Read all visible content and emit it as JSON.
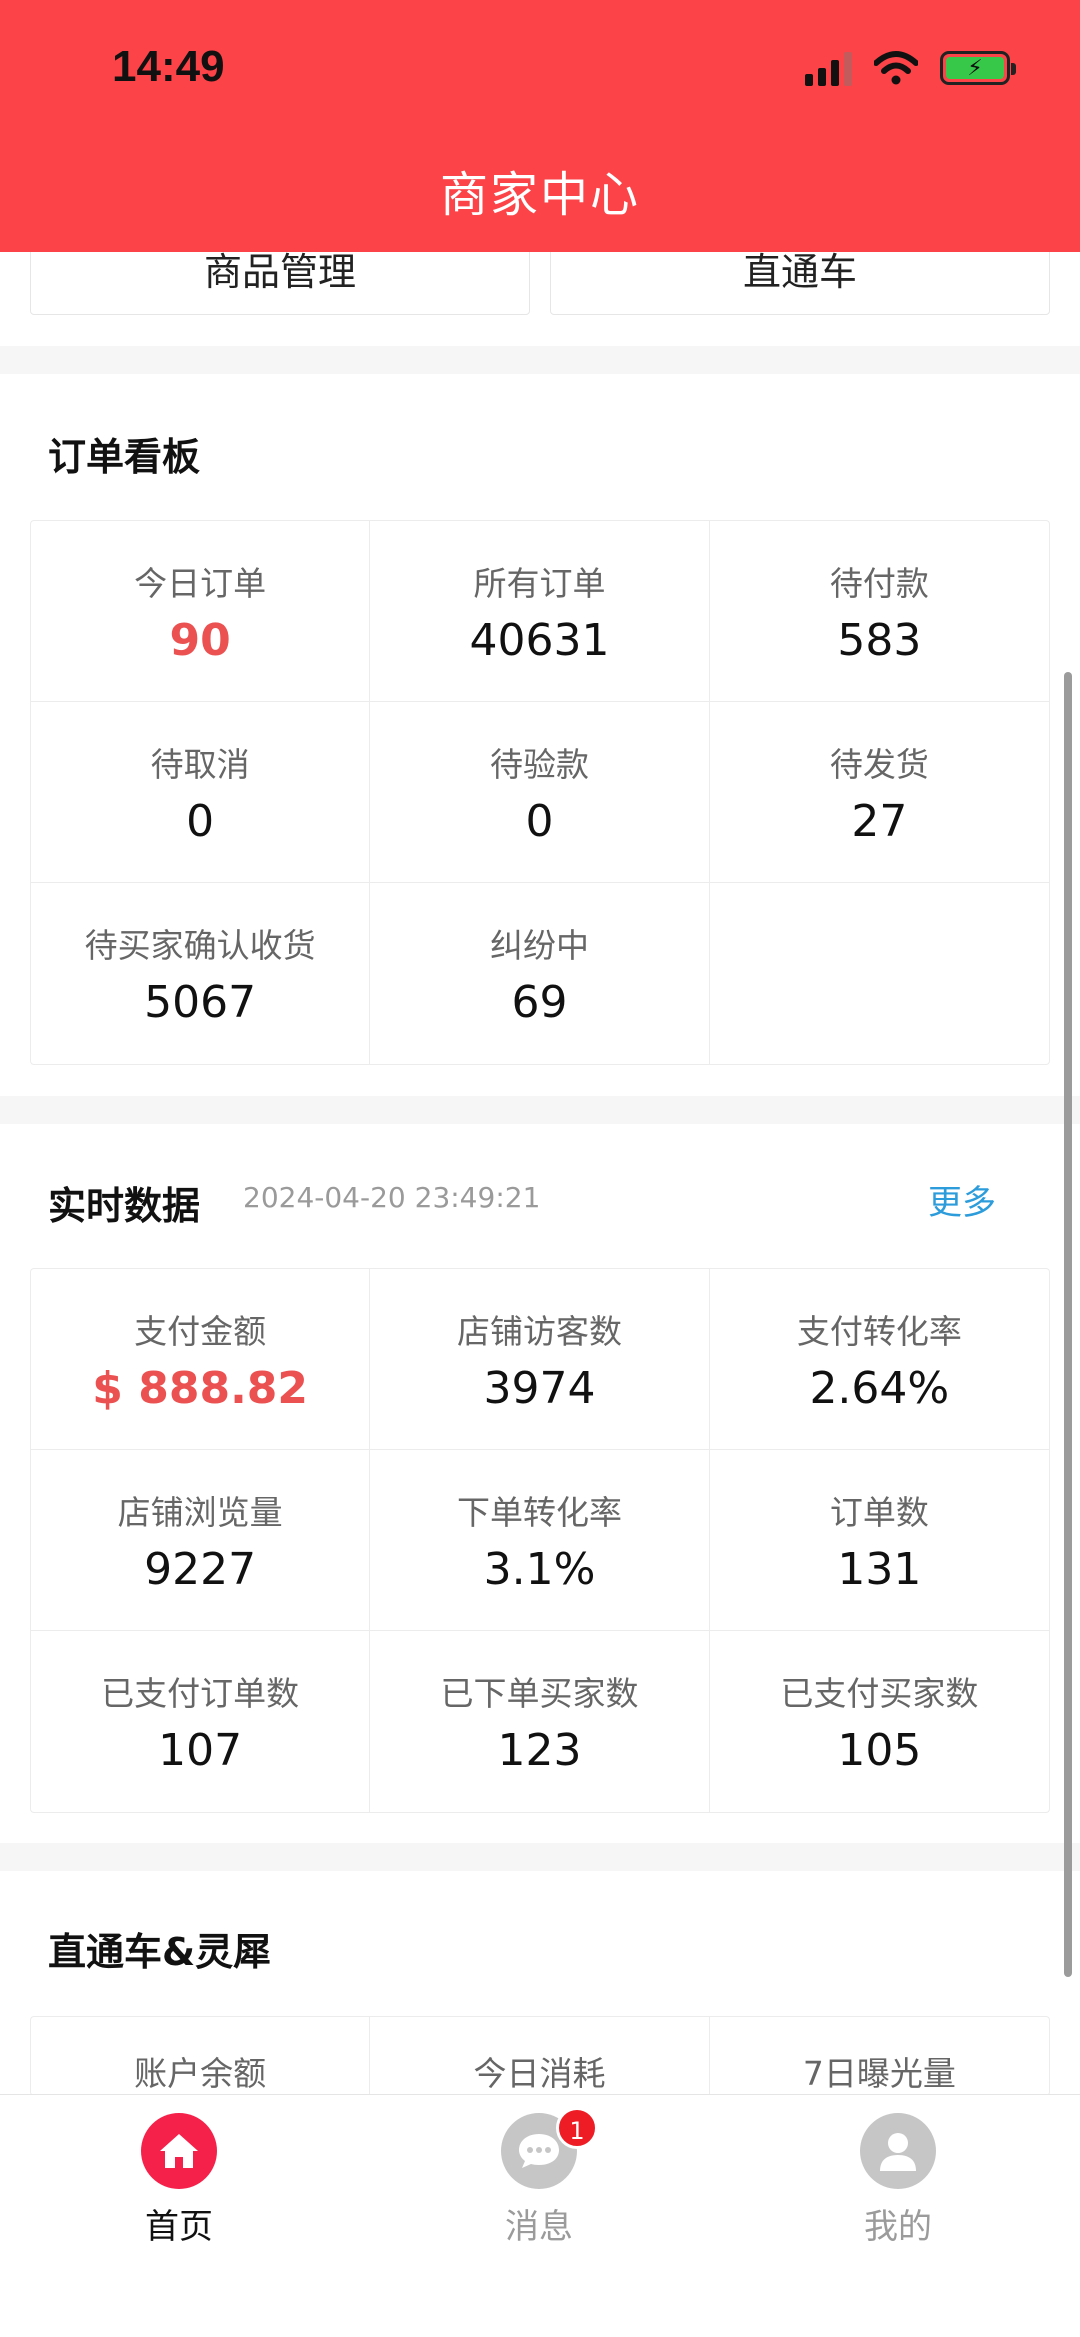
{
  "status_bar": {
    "time": "14:49"
  },
  "header": {
    "title": "商家中心"
  },
  "top_buttons": [
    {
      "label": "商品管理"
    },
    {
      "label": "直通车"
    }
  ],
  "order_board": {
    "title": "订单看板",
    "cells": [
      {
        "label": "今日订单",
        "value": "90",
        "highlight": true
      },
      {
        "label": "所有订单",
        "value": "40631"
      },
      {
        "label": "待付款",
        "value": "583"
      },
      {
        "label": "待取消",
        "value": "0"
      },
      {
        "label": "待验款",
        "value": "0"
      },
      {
        "label": "待发货",
        "value": "27"
      },
      {
        "label": "待买家确认收货",
        "value": "5067"
      },
      {
        "label": "纠纷中",
        "value": "69"
      },
      {
        "label": "",
        "value": ""
      }
    ]
  },
  "realtime": {
    "title": "实时数据",
    "timestamp": "2024-04-20 23:49:21",
    "more_label": "更多",
    "cells": [
      {
        "label": "支付金额",
        "value": "$ 888.82",
        "highlight": true
      },
      {
        "label": "店铺访客数",
        "value": "3974"
      },
      {
        "label": "支付转化率",
        "value": "2.64%"
      },
      {
        "label": "店铺浏览量",
        "value": "9227"
      },
      {
        "label": "下单转化率",
        "value": "3.1%"
      },
      {
        "label": "订单数",
        "value": "131"
      },
      {
        "label": "已支付订单数",
        "value": "107"
      },
      {
        "label": "已下单买家数",
        "value": "123"
      },
      {
        "label": "已支付买家数",
        "value": "105"
      }
    ]
  },
  "ads": {
    "title": "直通车&灵犀",
    "cells": [
      {
        "label": "账户余额"
      },
      {
        "label": "今日消耗"
      },
      {
        "label": "7日曝光量"
      }
    ]
  },
  "tabbar": {
    "tabs": [
      {
        "label": "首页",
        "icon": "home-icon",
        "active": true
      },
      {
        "label": "消息",
        "icon": "chat-icon",
        "badge": "1"
      },
      {
        "label": "我的",
        "icon": "user-icon"
      }
    ]
  },
  "colors": {
    "header_bg": "#fc4348",
    "highlight": "#ec5151",
    "link": "#2d9cdb",
    "tab_active": "#f5214a"
  }
}
